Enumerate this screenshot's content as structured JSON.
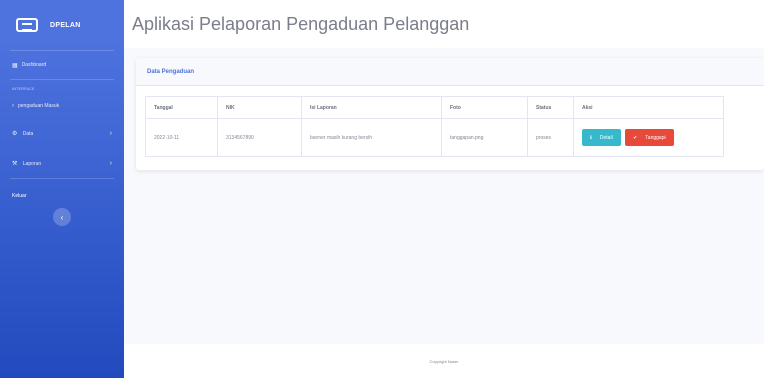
{
  "sidebar": {
    "brand": "DPELAN",
    "dashboard_label": "Dashboard",
    "heading": "Interface",
    "items": [
      {
        "label": "pengaduan Masuk",
        "icon": "chevron-right-icon"
      },
      {
        "label": "Data",
        "icon": "gear-icon"
      },
      {
        "label": "Laporan",
        "icon": "wrench-icon"
      }
    ],
    "logout": "Keluar"
  },
  "header": {
    "title": "Aplikasi Pelaporan Pengaduan Pelanggan"
  },
  "card": {
    "title": "Data Pengaduan"
  },
  "table": {
    "columns": [
      "Tanggal",
      "NIK",
      "Isi Laporan",
      "Foto",
      "Status",
      "Aksi"
    ],
    "rows": [
      {
        "tanggal": "2022-10-11",
        "nik": "3134567890",
        "isi": "banner masih kurang bersih",
        "foto": "tanggapan.png",
        "status": "proses",
        "detail_label": "Detail",
        "tanggapi_label": "Tanggapi"
      }
    ]
  },
  "footer": {
    "copyright": "Copyright Naser"
  },
  "colors": {
    "sidebar": "#4e73df",
    "info": "#36b9cc",
    "danger": "#e74a3b"
  }
}
